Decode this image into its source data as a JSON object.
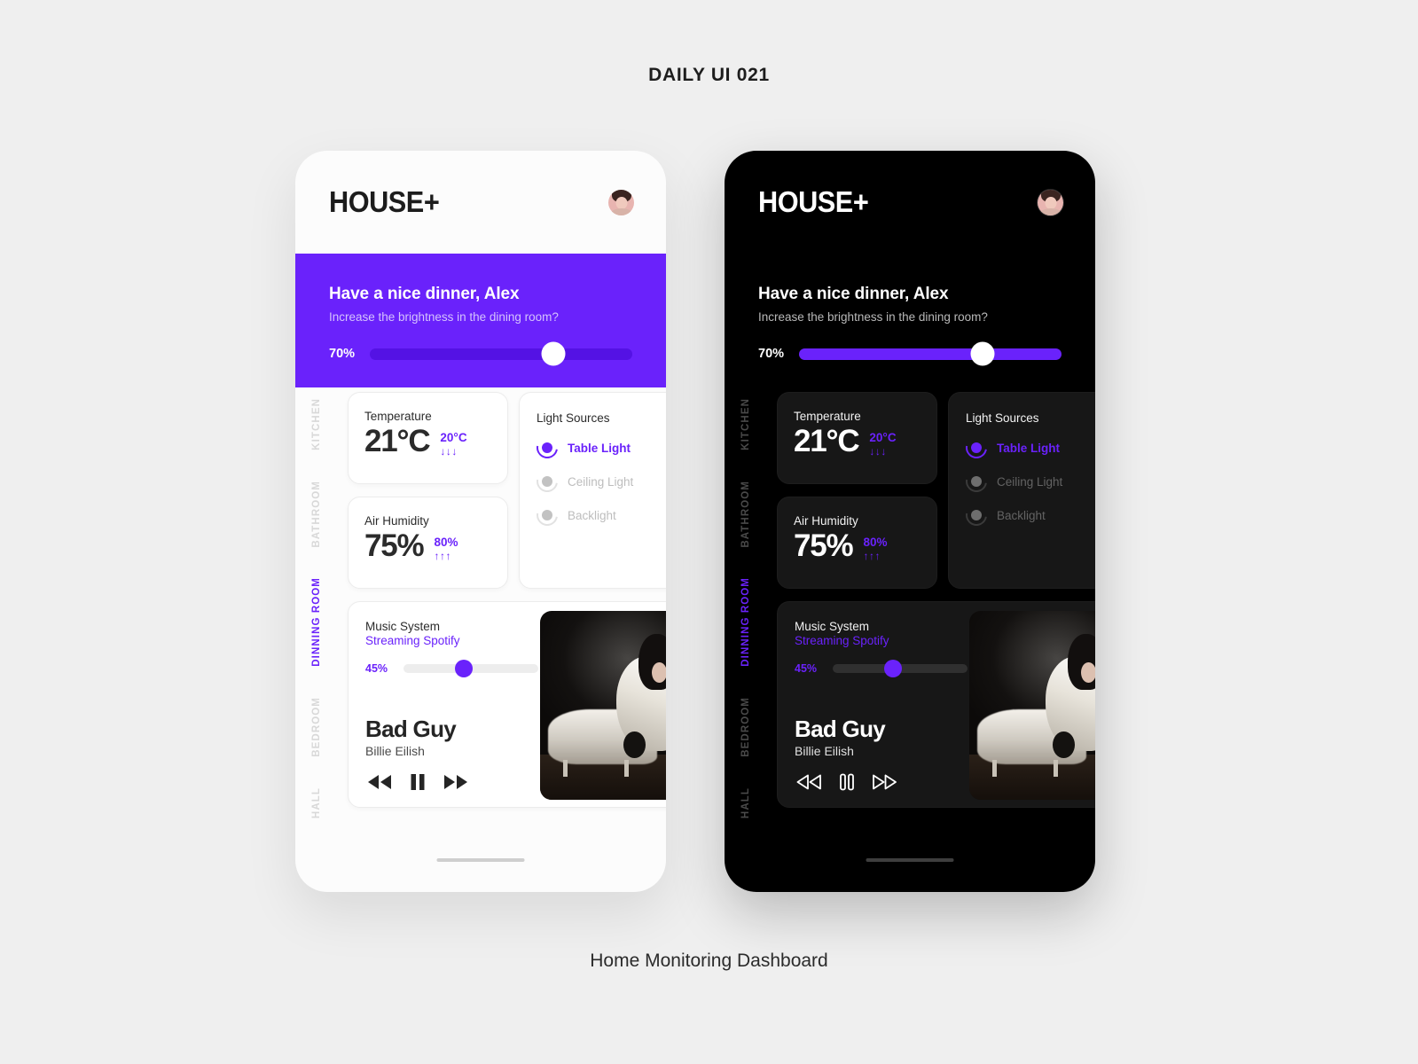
{
  "page": {
    "title": "DAILY UI 021",
    "caption": "Home Monitoring Dashboard",
    "accent_color": "#6a22fb",
    "background_color": "#efefef"
  },
  "app": {
    "brand": "HOUSE+",
    "avatar_name": "user-avatar",
    "banner": {
      "greeting": "Have a nice dinner, Alex",
      "question": "Increase the brightness in the dining room?",
      "brightness_percent": "70%",
      "brightness_value": 70
    },
    "nav": {
      "items": [
        {
          "label": "KITCHEN",
          "active": false
        },
        {
          "label": "BATHROOM",
          "active": false
        },
        {
          "label": "DINNING ROOM",
          "active": true
        },
        {
          "label": "BEDROOM",
          "active": false
        },
        {
          "label": "HALL",
          "active": false
        }
      ]
    },
    "cards": {
      "temperature": {
        "label": "Temperature",
        "value": "21°C",
        "secondary": "20°C",
        "trend_arrows": "↓↓↓",
        "trend": "down"
      },
      "humidity": {
        "label": "Air Humidity",
        "value": "75%",
        "secondary": "80%",
        "trend_arrows": "↑↑↑",
        "trend": "up"
      },
      "lights": {
        "label": "Light Sources",
        "sources": [
          {
            "name": "Table Light",
            "on": true
          },
          {
            "name": "Ceiling Light",
            "on": false
          },
          {
            "name": "Backlight",
            "on": false
          }
        ]
      },
      "music": {
        "label": "Music System",
        "source": "Streaming Spotify",
        "volume_percent": "45%",
        "volume_value": 45,
        "song": "Bad Guy",
        "artist": "Billie Eilish",
        "controls": [
          {
            "name": "rewind-button",
            "icon": "rewind-icon"
          },
          {
            "name": "pause-button",
            "icon": "pause-icon"
          },
          {
            "name": "forward-button",
            "icon": "forward-icon"
          }
        ]
      }
    }
  },
  "themes": [
    {
      "id": "light",
      "name": "Light Theme"
    },
    {
      "id": "dark",
      "name": "Dark Theme"
    }
  ]
}
